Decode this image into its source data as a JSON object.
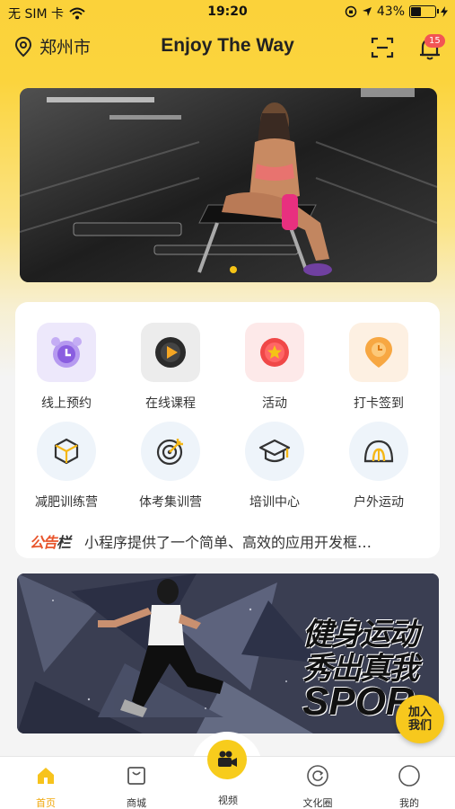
{
  "status_bar": {
    "carrier": "无 SIM 卡",
    "time": "19:20",
    "battery": "43%",
    "battery_level": 0.43
  },
  "nav": {
    "location": "郑州市",
    "title": "Enjoy The Way",
    "notification_count": "15"
  },
  "banner_top": {
    "image": "gym-woman-sitting-bench"
  },
  "grid": [
    {
      "label": "线上预约",
      "icon": "alarm-clock-icon"
    },
    {
      "label": "在线课程",
      "icon": "play-icon"
    },
    {
      "label": "活动",
      "icon": "star-medal-icon"
    },
    {
      "label": "打卡签到",
      "icon": "clock-pin-icon"
    },
    {
      "label": "减肥训练营",
      "icon": "cube-icon"
    },
    {
      "label": "体考集训营",
      "icon": "target-icon"
    },
    {
      "label": "培训中心",
      "icon": "graduation-cap-icon"
    },
    {
      "label": "户外运动",
      "icon": "tent-icon"
    }
  ],
  "notice": {
    "tag_a": "公告",
    "tag_b": "栏",
    "text": "小程序提供了一个简单、高效的应用开发框…"
  },
  "banner_bottom": {
    "line1": "健身运动",
    "line2": "秀出真我",
    "line3": "SPOR"
  },
  "join_button": {
    "line1": "加入",
    "line2": "我们"
  },
  "tabs": [
    {
      "label": "首页",
      "icon": "home-icon",
      "active": true
    },
    {
      "label": "商城",
      "icon": "shopping-bag-icon",
      "active": false
    },
    {
      "label": "视频",
      "icon": "video-camera-icon",
      "active": false
    },
    {
      "label": "文化圈",
      "icon": "refresh-circle-icon",
      "active": false
    },
    {
      "label": "我的",
      "icon": "profile-circle-icon",
      "active": false
    }
  ],
  "colors": {
    "brand_yellow": "#fbd23a",
    "active_tab": "#f0a80c",
    "notice_red": "#e8552c",
    "badge_red": "#f25454"
  }
}
